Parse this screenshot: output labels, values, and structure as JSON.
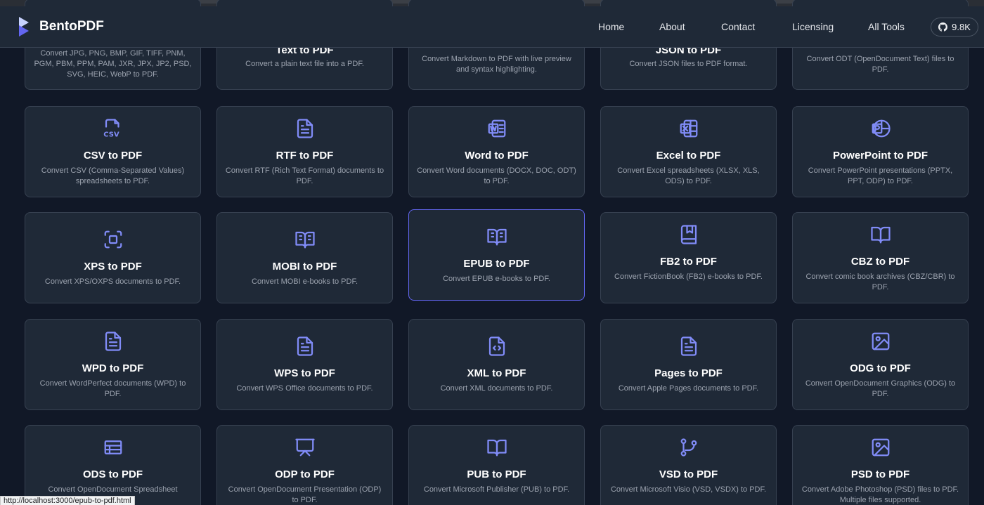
{
  "brand": {
    "name": "BentoPDF"
  },
  "nav": {
    "links": [
      "Home",
      "About",
      "Contact",
      "Licensing",
      "All Tools"
    ],
    "github_stars": "9.8K"
  },
  "tools": [
    {
      "title": "",
      "desc": "Convert JPG, PNG, BMP, GIF, TIFF, PNM, PGM, PBM, PPM, PAM, JXR, JPX, JP2, PSD, SVG, HEIC, WebP to PDF.",
      "icon": "image-icon"
    },
    {
      "title": "Text to PDF",
      "desc": "Convert a plain text file into a PDF.",
      "icon": "file-text-icon"
    },
    {
      "title": "",
      "desc": "Convert Markdown to PDF with live preview and syntax highlighting.",
      "icon": "markdown-icon"
    },
    {
      "title": "JSON to PDF",
      "desc": "Convert JSON files to PDF format.",
      "icon": "braces-icon"
    },
    {
      "title": "",
      "desc": "Convert ODT (OpenDocument Text) files to PDF.",
      "icon": "file-icon"
    },
    {
      "title": "CSV to PDF",
      "desc": "Convert CSV (Comma-Separated Values) spreadsheets to PDF.",
      "icon": "csv-file-icon"
    },
    {
      "title": "RTF to PDF",
      "desc": "Convert RTF (Rich Text Format) documents to PDF.",
      "icon": "file-text-icon"
    },
    {
      "title": "Word to PDF",
      "desc": "Convert Word documents (DOCX, DOC, ODT) to PDF.",
      "icon": "word-icon"
    },
    {
      "title": "Excel to PDF",
      "desc": "Convert Excel spreadsheets (XLSX, XLS, ODS) to PDF.",
      "icon": "excel-icon"
    },
    {
      "title": "PowerPoint to PDF",
      "desc": "Convert PowerPoint presentations (PPTX, PPT, ODP) to PDF.",
      "icon": "powerpoint-icon"
    },
    {
      "title": "XPS to PDF",
      "desc": "Convert XPS/OXPS documents to PDF.",
      "icon": "scan-icon"
    },
    {
      "title": "MOBI to PDF",
      "desc": "Convert MOBI e-books to PDF.",
      "icon": "book-open-text-icon"
    },
    {
      "title": "EPUB to PDF",
      "desc": "Convert EPUB e-books to PDF.",
      "icon": "book-open-text-icon"
    },
    {
      "title": "FB2 to PDF",
      "desc": "Convert FictionBook (FB2) e-books to PDF.",
      "icon": "book-marked-icon"
    },
    {
      "title": "CBZ to PDF",
      "desc": "Convert comic book archives (CBZ/CBR) to PDF.",
      "icon": "book-open-icon"
    },
    {
      "title": "WPD to PDF",
      "desc": "Convert WordPerfect documents (WPD) to PDF.",
      "icon": "file-text-icon"
    },
    {
      "title": "WPS to PDF",
      "desc": "Convert WPS Office documents to PDF.",
      "icon": "file-text-icon"
    },
    {
      "title": "XML to PDF",
      "desc": "Convert XML documents to PDF.",
      "icon": "file-code-icon"
    },
    {
      "title": "Pages to PDF",
      "desc": "Convert Apple Pages documents to PDF.",
      "icon": "file-text-icon"
    },
    {
      "title": "ODG to PDF",
      "desc": "Convert OpenDocument Graphics (ODG) to PDF.",
      "icon": "image-icon"
    },
    {
      "title": "ODS to PDF",
      "desc": "Convert OpenDocument Spreadsheet",
      "icon": "table-icon"
    },
    {
      "title": "ODP to PDF",
      "desc": "Convert OpenDocument Presentation (ODP) to PDF.",
      "icon": "presentation-icon"
    },
    {
      "title": "PUB to PDF",
      "desc": "Convert Microsoft Publisher (PUB) to PDF.",
      "icon": "book-open-icon"
    },
    {
      "title": "VSD to PDF",
      "desc": "Convert Microsoft Visio (VSD, VSDX) to PDF.",
      "icon": "git-branch-icon"
    },
    {
      "title": "PSD to PDF",
      "desc": "Convert Adobe Photoshop (PSD) files to PDF. Multiple files supported.",
      "icon": "image-icon"
    }
  ],
  "status_bar": {
    "url": "http://localhost:3000/epub-to-pdf.html"
  },
  "colors": {
    "accent": "#818cf8",
    "hover_border": "#6366f1",
    "card_bg": "#1f2937",
    "page_bg": "#111827"
  }
}
